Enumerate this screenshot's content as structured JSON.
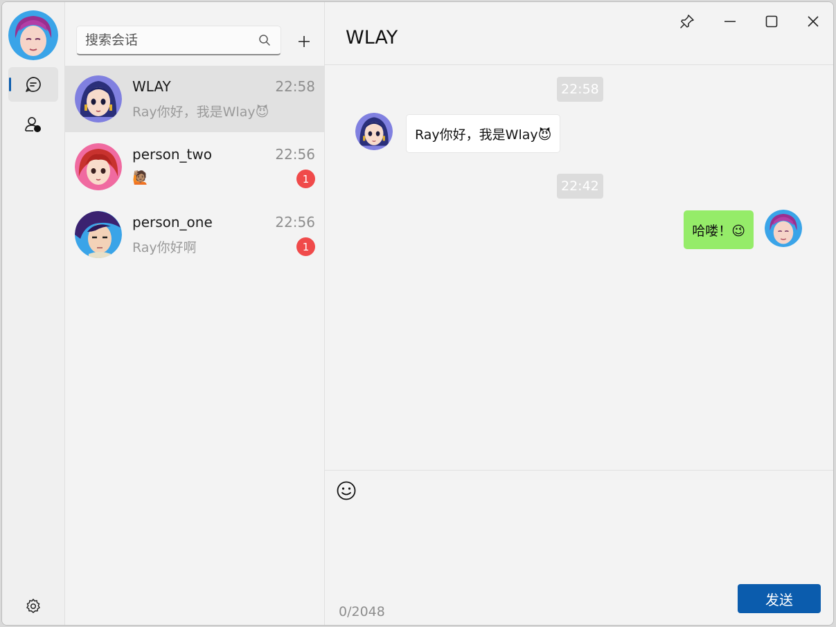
{
  "rail": {
    "my_avatar": "avatar-purple-hair-me",
    "nav": [
      {
        "key": "chats",
        "icon": "chat-bubble-icon",
        "active": true
      },
      {
        "key": "contacts",
        "icon": "contacts-icon",
        "active": false
      }
    ],
    "settings_icon": "gear-icon"
  },
  "search": {
    "placeholder": "搜索会话",
    "value": ""
  },
  "add_icon": "plus-icon",
  "conversations": [
    {
      "name": "WLAY",
      "time": "22:58",
      "preview": "Ray你好，我是Wlay😈",
      "unread": null,
      "selected": true,
      "avatar": "avatar-blue-hair"
    },
    {
      "name": "person_two",
      "time": "22:56",
      "preview": "🙋🏽",
      "unread": "1",
      "selected": false,
      "avatar": "avatar-red-hair"
    },
    {
      "name": "person_one",
      "time": "22:56",
      "preview": "Ray你好啊",
      "unread": "1",
      "selected": false,
      "avatar": "avatar-dark-hair"
    }
  ],
  "chat": {
    "title": "WLAY",
    "window_controls": [
      "pin-icon",
      "minimize-icon",
      "maximize-icon",
      "close-icon"
    ],
    "messages": [
      {
        "type": "time",
        "text": "22:58"
      },
      {
        "type": "in",
        "text": "Ray你好，我是Wlay😈",
        "avatar": "avatar-blue-hair"
      },
      {
        "type": "time",
        "text": "22:42"
      },
      {
        "type": "out",
        "text": "哈喽！😉",
        "avatar": "avatar-purple-hair-me"
      }
    ],
    "composer": {
      "emoji_icon": "smiley-icon",
      "counter": "0/2048",
      "send_label": "发送",
      "value": ""
    }
  },
  "colors": {
    "accent": "#0b5cad",
    "badge": "#f04a4a",
    "outgoing_bubble": "#95ec69"
  }
}
